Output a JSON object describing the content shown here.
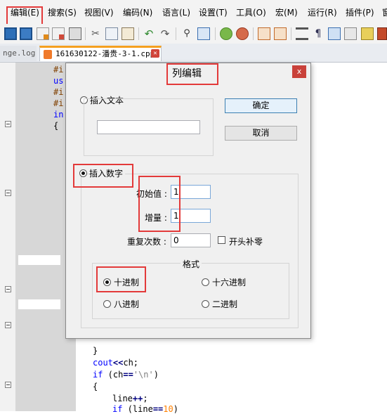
{
  "menu": {
    "items": [
      "编辑(E)",
      "搜索(S)",
      "视图(V)",
      "编码(N)",
      "语言(L)",
      "设置(T)",
      "工具(O)",
      "宏(M)",
      "运行(R)",
      "插件(P)",
      "窗"
    ]
  },
  "tabs": {
    "inactive_label": "nge.log",
    "active_label": "161630122-潘贵-3-1.cpp"
  },
  "code": {
    "line1": "#i",
    "line2": "us",
    "line3": "#i",
    "line4": "#i",
    "line5": "in",
    "line6": "{",
    "lower_close_brace": "}",
    "cout_kw": "cout",
    "cout_op": "<<",
    "cout_rest": "ch;",
    "if_kw": "if",
    "if_open": " (ch",
    "if_op": "==",
    "if_str": "'\\n'",
    "if_close": ")",
    "open_brace": "{",
    "line_inc": "line",
    "line_inc_op": "++",
    "line_inc_end": ";",
    "if2_kw": "if",
    "if2_open": " (line",
    "if2_op": "==",
    "if2_num": "10",
    "if2_close": ")"
  },
  "dialog": {
    "title": "列编辑",
    "close": "x",
    "insert_text_label": "插入文本",
    "insert_text_value": "",
    "ok_button": "确定",
    "cancel_button": "取消",
    "insert_number_label": "插入数字",
    "initial_value_label": "初始值 :",
    "initial_value": "1",
    "increment_label": "增量 :",
    "increment_value": "1",
    "repeat_label": "重复次数 :",
    "repeat_value": "0",
    "leading_zeros_label": "开头补零",
    "leading_zeros_checked": false,
    "format_legend": "格式",
    "format_options": [
      "十进制",
      "十六进制",
      "八进制",
      "二进制"
    ],
    "format_selected": "十进制",
    "insert_mode_selected": "插入数字"
  },
  "colors": {
    "annotation_red": "#e33a3a",
    "keyword_blue": "#0000ff",
    "tab_accent": "#f5a020"
  }
}
